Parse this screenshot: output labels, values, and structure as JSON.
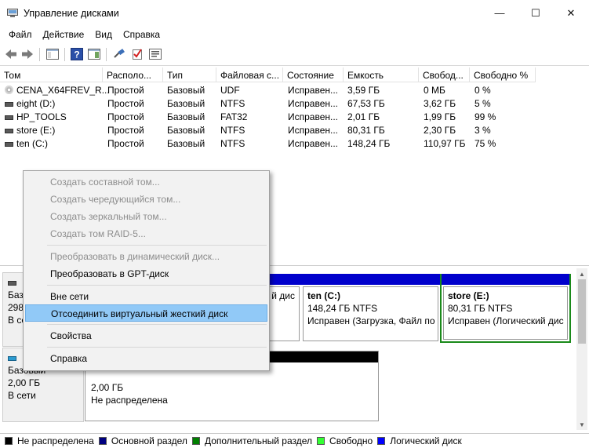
{
  "window": {
    "title": "Управление дисками",
    "minimize": "—",
    "maximize": "☐",
    "close": "✕"
  },
  "menu": [
    "Файл",
    "Действие",
    "Вид",
    "Справка"
  ],
  "toolbar": {
    "icons": [
      "back-arrow",
      "forward-arrow",
      "console-tree",
      "help",
      "properties-pane",
      "connect",
      "check",
      "settings-list"
    ]
  },
  "table": {
    "headers": [
      "Том",
      "Располо...",
      "Тип",
      "Файловая с...",
      "Состояние",
      "Емкость",
      "Свобод...",
      "Свободно %"
    ],
    "rows": [
      {
        "icon": "cd-icon",
        "cells": [
          "CENA_X64FREV_R...",
          "Простой",
          "Базовый",
          "UDF",
          "Исправен...",
          "3,59 ГБ",
          "0 МБ",
          "0 %"
        ]
      },
      {
        "icon": "volume-icon",
        "cells": [
          "eight (D:)",
          "Простой",
          "Базовый",
          "NTFS",
          "Исправен...",
          "67,53 ГБ",
          "3,62 ГБ",
          "5 %"
        ]
      },
      {
        "icon": "volume-icon",
        "cells": [
          "HP_TOOLS",
          "Простой",
          "Базовый",
          "FAT32",
          "Исправен...",
          "2,01 ГБ",
          "1,99 ГБ",
          "99 %"
        ]
      },
      {
        "icon": "volume-icon",
        "cells": [
          "store (E:)",
          "Простой",
          "Базовый",
          "NTFS",
          "Исправен...",
          "80,31 ГБ",
          "2,30 ГБ",
          "3 %"
        ]
      },
      {
        "icon": "volume-icon",
        "cells": [
          "ten (C:)",
          "Простой",
          "Базовый",
          "NTFS",
          "Исправен...",
          "148,24 ГБ",
          "110,97 ГБ",
          "75 %"
        ]
      }
    ]
  },
  "disks": [
    {
      "label_lines": [
        "",
        "Базо",
        "298",
        "В се"
      ],
      "partitions": [
        {
          "title": "",
          "size": "",
          "status": "й дис",
          "bar_color": "#0000cc"
        },
        {
          "title": "ten (C:)",
          "size": "148,24 ГБ NTFS",
          "status": "Исправен (Загрузка, Файл по",
          "bar_color": "#0000cc"
        },
        {
          "title": "store (E:)",
          "size": "80,31 ГБ NTFS",
          "status": "Исправен (Логический дис",
          "bar_color": "#0000cc"
        }
      ]
    },
    {
      "label_lines": [
        "",
        "Базовый",
        "2,00 ГБ",
        "В сети"
      ],
      "partitions": [
        {
          "title": "",
          "size": "2,00 ГБ",
          "status": "Не распределена",
          "bar_color": "#000000"
        }
      ]
    }
  ],
  "legend": [
    {
      "label": "Не распределена",
      "color": "#000000"
    },
    {
      "label": "Основной раздел",
      "color": "#000080"
    },
    {
      "label": "Дополнительный раздел",
      "color": "#008000"
    },
    {
      "label": "Свободно",
      "color": "#33ff33"
    },
    {
      "label": "Логический диск",
      "color": "#0000ff"
    }
  ],
  "context_menu": {
    "items": [
      {
        "label": "Создать составной том...",
        "enabled": false
      },
      {
        "label": "Создать чередующийся том...",
        "enabled": false
      },
      {
        "label": "Создать зеркальный том...",
        "enabled": false
      },
      {
        "label": "Создать том RAID-5...",
        "enabled": false
      },
      {
        "label": "Преобразовать в динамический диск...",
        "enabled": false
      },
      {
        "label": "Преобразовать в GPT-диск",
        "enabled": true
      },
      {
        "label": "Вне сети",
        "enabled": true
      },
      {
        "label": "Отсоединить виртуальный жесткий диск",
        "enabled": true,
        "highlighted": true
      },
      {
        "label": "Свойства",
        "enabled": true
      },
      {
        "label": "Справка",
        "enabled": true
      }
    ]
  }
}
